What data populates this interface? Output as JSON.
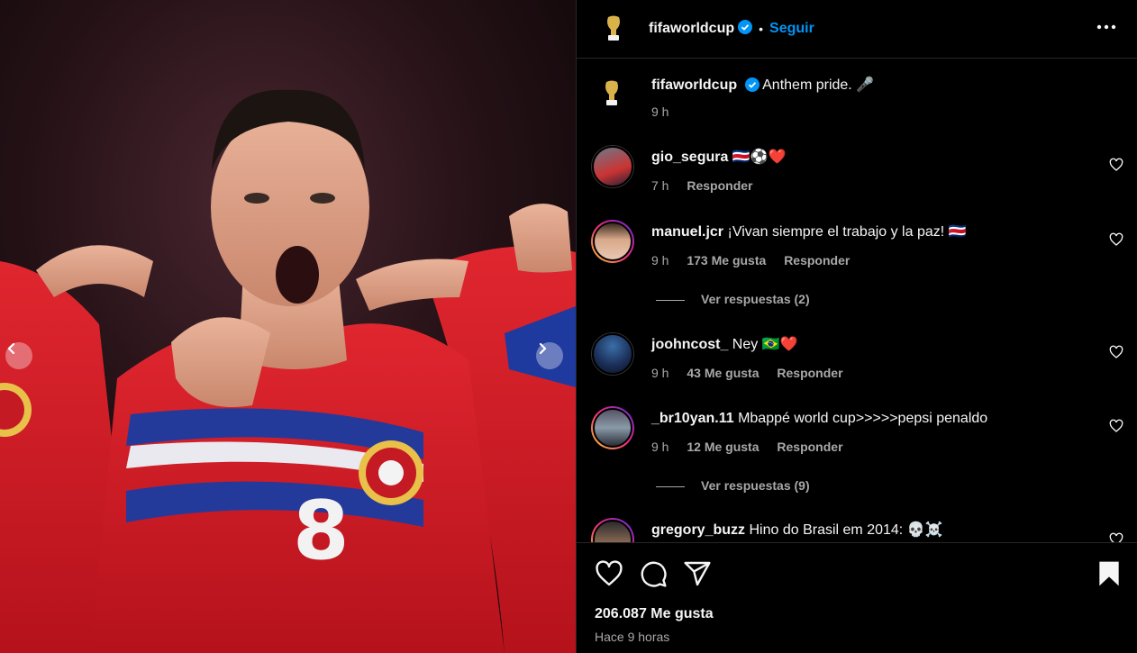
{
  "post": {
    "author": "fifaworldcup",
    "follow_label": "Seguir",
    "caption": "Anthem pride. 🎤",
    "caption_time": "9 h",
    "likes": "206.087 Me gusta",
    "posted": "Hace 9 horas"
  },
  "colors": {
    "accent": "#0095f6",
    "secondary_text": "#a8a8a8",
    "jersey_red": "#d81f2a"
  },
  "comments": [
    {
      "user": "gio_segura",
      "text": "🇨🇷⚽❤️",
      "time": "7 h",
      "likes": "",
      "reply": "Responder"
    },
    {
      "user": "manuel.jcr",
      "text": "¡Vivan siempre el trabajo y la paz! 🇨🇷",
      "time": "9 h",
      "likes": "173 Me gusta",
      "reply": "Responder",
      "replies": "Ver respuestas (2)"
    },
    {
      "user": "joohncost_",
      "text": "Ney 🇧🇷❤️",
      "time": "9 h",
      "likes": "43 Me gusta",
      "reply": "Responder"
    },
    {
      "user": "_br10yan.11",
      "text": "Mbappé world cup>>>>>pepsi penaldo",
      "time": "9 h",
      "likes": "12 Me gusta",
      "reply": "Responder",
      "replies": "Ver respuestas (9)"
    },
    {
      "user": "gregory_buzz",
      "text": "Hino do Brasil em 2014: 💀☠️"
    }
  ],
  "icons": {
    "media_prev": "chevron-left-icon",
    "media_next": "chevron-right-icon",
    "verified": "verified-badge-icon",
    "more": "more-options-icon",
    "like": "heart-icon",
    "comment": "comment-icon",
    "share": "share-icon",
    "save": "bookmark-icon"
  }
}
